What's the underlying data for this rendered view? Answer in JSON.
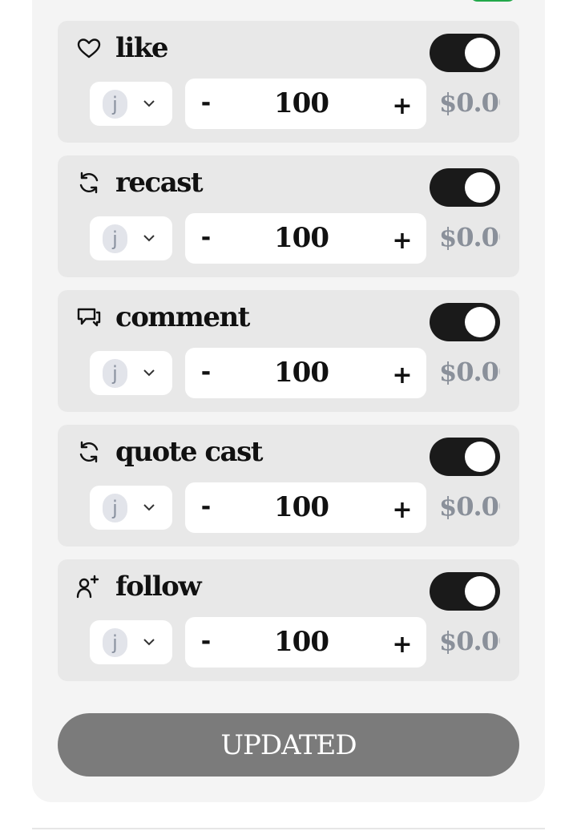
{
  "actions": [
    {
      "id": "like",
      "label": "like",
      "icon": "heart-icon",
      "enabled": true,
      "token": "j",
      "amount": "100",
      "decrement": "-",
      "increment": "+",
      "price": "$0.00"
    },
    {
      "id": "recast",
      "label": "recast",
      "icon": "refresh-icon",
      "enabled": true,
      "token": "j",
      "amount": "100",
      "decrement": "-",
      "increment": "+",
      "price": "$0.00"
    },
    {
      "id": "comment",
      "label": "comment",
      "icon": "chat-bubbles-icon",
      "enabled": true,
      "token": "j",
      "amount": "100",
      "decrement": "-",
      "increment": "+",
      "price": "$0.00"
    },
    {
      "id": "quote-cast",
      "label": "quote cast",
      "icon": "refresh-icon",
      "enabled": true,
      "token": "j",
      "amount": "100",
      "decrement": "-",
      "increment": "+",
      "price": "$0.00"
    },
    {
      "id": "follow",
      "label": "follow",
      "icon": "user-plus-icon",
      "enabled": true,
      "token": "j",
      "amount": "100",
      "decrement": "-",
      "increment": "+",
      "price": "$0.00"
    }
  ],
  "submit": {
    "label": "UPDATED"
  },
  "colors": {
    "panel_bg": "#f4f4f4",
    "card_bg": "#e8e8e8",
    "toggle_on": "#1a1a1a",
    "price_text": "#8a909a",
    "submit_bg": "#7b7b7b",
    "badge_green": "#22a84a"
  }
}
